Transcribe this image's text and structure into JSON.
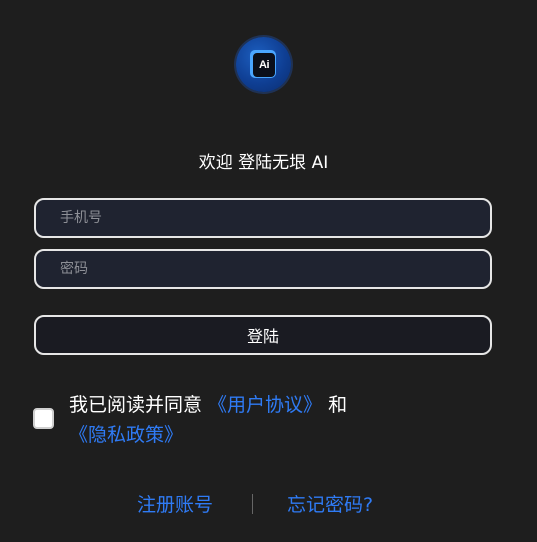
{
  "logo": {
    "icon": "ai-app-logo",
    "text": "Ai",
    "accent_color": "#1d5fc0"
  },
  "welcome_title": "欢迎 登陆无垠 AI",
  "form": {
    "phone_placeholder": "手机号",
    "phone_value": "",
    "password_placeholder": "密码",
    "password_value": "",
    "login_label": "登陆"
  },
  "agreement": {
    "checked": false,
    "prefix": "我已阅读并同意 ",
    "user_agreement": "《用户协议》",
    "joiner": " 和 ",
    "privacy_policy": "《隐私政策》"
  },
  "footer": {
    "register_label": "注册账号",
    "forgot_label": "忘记密码?",
    "link_color": "#2f7bf5"
  }
}
